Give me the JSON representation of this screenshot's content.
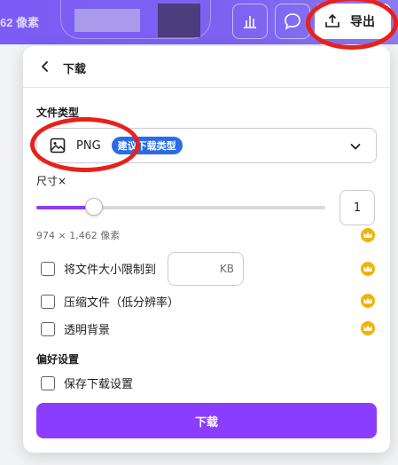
{
  "topbar": {
    "pixel_size_label": "62 像素",
    "export_label": "导出",
    "icons": [
      "bar-chart-icon",
      "comment-icon",
      "upload-icon"
    ]
  },
  "panel": {
    "title": "下载",
    "file_type": {
      "label": "文件类型",
      "value": "PNG",
      "badge": "建议下载类型"
    },
    "size": {
      "label": "尺寸×",
      "scale_value": "1",
      "slider_fraction": 0.2,
      "dimensions": "974 × 1,462 像素"
    },
    "options": [
      {
        "label": "将文件大小限制到",
        "checked": false
      },
      {
        "label": "压缩文件（低分辨率）",
        "checked": false
      },
      {
        "label": "透明背景",
        "checked": false
      }
    ],
    "kb_unit": "KB",
    "preferences": {
      "label": "偏好设置",
      "save_label": "保存下载设置"
    },
    "download_label": "下载"
  },
  "colors": {
    "brand_purple": "#8b3dff",
    "badge_blue": "#2b6be8",
    "crown_gold": "#f5b100",
    "annotation_red": "#e8211a"
  }
}
